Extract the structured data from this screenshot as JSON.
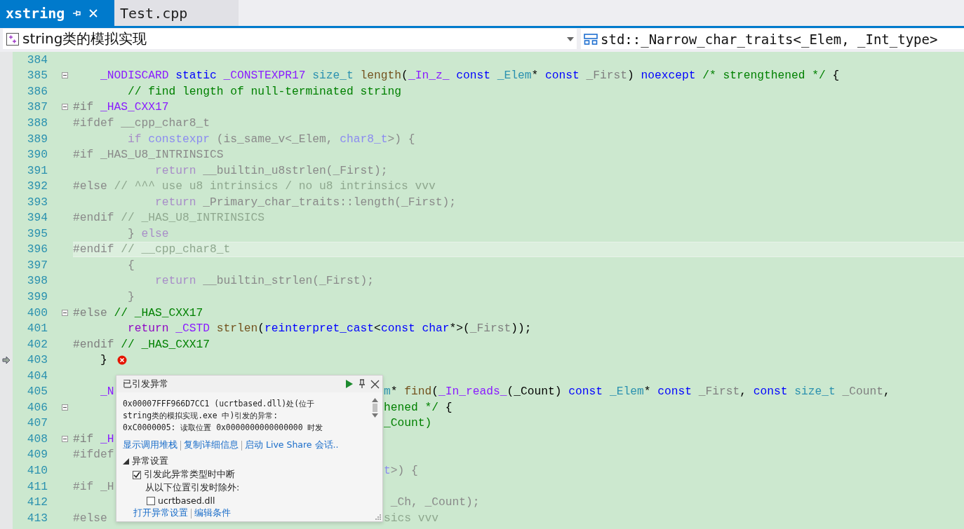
{
  "tabs": [
    {
      "label": "xstring",
      "selected": true
    },
    {
      "label": "Test.cpp",
      "selected": false
    }
  ],
  "nav": {
    "project": "string类的模拟实现",
    "scope": "std::_Narrow_char_traits<_Elem, _Int_type>"
  },
  "lines": [
    {
      "number": "384"
    },
    {
      "number": "385",
      "fold": true,
      "left": [
        {
          "t": "    _NODISCARD ",
          "kind": "mac"
        },
        {
          "t": "static ",
          "kind": "kw"
        },
        {
          "t": "_CONSTEXPR17 ",
          "kind": "mac"
        },
        {
          "t": "size_t ",
          "kind": "type"
        },
        {
          "t": "length",
          "kind": "fn"
        },
        {
          "t": "(",
          "kind": "pl"
        },
        {
          "t": "_In_z_ ",
          "kind": "mac"
        },
        {
          "t": "const ",
          "kind": "kw"
        },
        {
          "t": "_Elem",
          "kind": "type"
        },
        {
          "t": "* ",
          "kind": "pl"
        },
        {
          "t": "const ",
          "kind": "kw"
        },
        {
          "t": "_First",
          "kind": "par"
        },
        {
          "t": ") ",
          "kind": "pl"
        },
        {
          "t": "noexcept ",
          "kind": "kw"
        },
        {
          "t": "/* strengthened */",
          "kind": "cm"
        },
        {
          "t": " {",
          "kind": "pl"
        }
      ]
    },
    {
      "number": "386",
      "left": [
        {
          "t": "        // find length of null-terminated string",
          "kind": "cm"
        }
      ]
    },
    {
      "number": "387",
      "fold": true,
      "left": [
        {
          "t": "#if ",
          "kind": "pre"
        },
        {
          "t": "_HAS_CXX17",
          "kind": "mac"
        }
      ]
    },
    {
      "number": "388",
      "left": [
        {
          "t": "#ifdef __cpp_char8_t",
          "kind": "ip"
        }
      ]
    },
    {
      "number": "389",
      "left": [
        {
          "t": "        if ",
          "kind": "ictl"
        },
        {
          "t": "constexpr",
          "kind": "ikw"
        },
        {
          "t": " (is_same_v<_Elem, ",
          "kind": "ip"
        },
        {
          "t": "char8_t",
          "kind": "ikw"
        },
        {
          "t": ">) {",
          "kind": "ip"
        }
      ]
    },
    {
      "number": "390",
      "left": [
        {
          "t": "#if _HAS_U8_INTRINSICS",
          "kind": "ip"
        }
      ]
    },
    {
      "number": "391",
      "left": [
        {
          "t": "            return",
          "kind": "ictl"
        },
        {
          "t": " __builtin_u8strlen(_First);",
          "kind": "ip"
        }
      ]
    },
    {
      "number": "392",
      "left": [
        {
          "t": "#else",
          "kind": "ip"
        },
        {
          "t": " // ^^^ use u8 intrinsics / no u8 intrinsics vvv",
          "kind": "icm"
        }
      ]
    },
    {
      "number": "393",
      "left": [
        {
          "t": "            return",
          "kind": "ictl"
        },
        {
          "t": " _Primary_char_traits::length(_First);",
          "kind": "ip"
        }
      ]
    },
    {
      "number": "394",
      "left": [
        {
          "t": "#endif",
          "kind": "ip"
        },
        {
          "t": " // _HAS_U8_INTRINSICS",
          "kind": "icm"
        }
      ]
    },
    {
      "number": "395",
      "left": [
        {
          "t": "        } ",
          "kind": "ip"
        },
        {
          "t": "else",
          "kind": "ictl"
        }
      ]
    },
    {
      "number": "396",
      "current": true,
      "left": [
        {
          "t": "#endif",
          "kind": "ip"
        },
        {
          "t": " // __cpp_char8_t",
          "kind": "icm"
        }
      ]
    },
    {
      "number": "397",
      "left": [
        {
          "t": "        {",
          "kind": "ip"
        }
      ]
    },
    {
      "number": "398",
      "left": [
        {
          "t": "            return",
          "kind": "ictl"
        },
        {
          "t": " __builtin_strlen(_First);",
          "kind": "ip"
        }
      ]
    },
    {
      "number": "399",
      "left": [
        {
          "t": "        }",
          "kind": "ip"
        }
      ]
    },
    {
      "number": "400",
      "fold": true,
      "left": [
        {
          "t": "#else",
          "kind": "pre"
        },
        {
          "t": " // _HAS_CXX17",
          "kind": "cm"
        }
      ]
    },
    {
      "number": "401",
      "left": [
        {
          "t": "        return ",
          "kind": "ctl"
        },
        {
          "t": "_CSTD ",
          "kind": "mac"
        },
        {
          "t": "strlen",
          "kind": "fn"
        },
        {
          "t": "(",
          "kind": "pl"
        },
        {
          "t": "reinterpret_cast",
          "kind": "kw"
        },
        {
          "t": "<",
          "kind": "pl"
        },
        {
          "t": "const char",
          "kind": "kw"
        },
        {
          "t": "*>(",
          "kind": "pl"
        },
        {
          "t": "_First",
          "kind": "par"
        },
        {
          "t": "));",
          "kind": "pl"
        }
      ]
    },
    {
      "number": "402",
      "left": [
        {
          "t": "#endif",
          "kind": "pre"
        },
        {
          "t": " // _HAS_CXX17",
          "kind": "cm"
        }
      ]
    },
    {
      "number": "403",
      "arrow": true,
      "error": true,
      "left": [
        {
          "t": "    }",
          "kind": "pl"
        }
      ]
    },
    {
      "number": "404"
    },
    {
      "number": "405",
      "left": [
        {
          "t": "    _N",
          "kind": "mac"
        }
      ],
      "right": [
        {
          "t": "m",
          "kind": "type"
        },
        {
          "t": "* ",
          "kind": "pl"
        },
        {
          "t": "find",
          "kind": "fn"
        },
        {
          "t": "(",
          "kind": "pl"
        },
        {
          "t": "_In_reads_",
          "kind": "mac"
        },
        {
          "t": "(_Count) ",
          "kind": "pl"
        },
        {
          "t": "const ",
          "kind": "kw"
        },
        {
          "t": "_Elem",
          "kind": "type"
        },
        {
          "t": "* ",
          "kind": "pl"
        },
        {
          "t": "const ",
          "kind": "kw"
        },
        {
          "t": "_First",
          "kind": "par"
        },
        {
          "t": ", ",
          "kind": "pl"
        },
        {
          "t": "const ",
          "kind": "kw"
        },
        {
          "t": "size_t ",
          "kind": "type"
        },
        {
          "t": "_Count",
          "kind": "par"
        },
        {
          "t": ",",
          "kind": "pl"
        }
      ]
    },
    {
      "number": "406",
      "fold": true,
      "right": [
        {
          "t": "hened */",
          "kind": "cm"
        },
        {
          "t": " {",
          "kind": "pl"
        }
      ]
    },
    {
      "number": "407",
      "right": [
        {
          "t": "_Count)",
          "kind": "cm"
        }
      ]
    },
    {
      "number": "408",
      "fold": true,
      "left": [
        {
          "t": "#if ",
          "kind": "pre"
        },
        {
          "t": "_H",
          "kind": "mac"
        }
      ]
    },
    {
      "number": "409",
      "left": [
        {
          "t": "#ifdef",
          "kind": "ip"
        }
      ]
    },
    {
      "number": "410",
      "right": [
        {
          "t": "t",
          "kind": "ikw"
        },
        {
          "t": ">) {",
          "kind": "ip"
        }
      ]
    },
    {
      "number": "411",
      "left": [
        {
          "t": "#if _H",
          "kind": "ip"
        }
      ]
    },
    {
      "number": "412",
      "right": [
        {
          "t": " _Ch, _Count);",
          "kind": "ip"
        }
      ]
    },
    {
      "number": "413",
      "left": [
        {
          "t": "#else",
          "kind": "ip"
        }
      ],
      "right": [
        {
          "t": "sics vvv",
          "kind": "icm"
        }
      ]
    }
  ],
  "popup": {
    "title": "已引发异常",
    "message": [
      "0x00007FFF966D7CC1 (ucrtbased.dll)处(位于",
      "string类的模拟实现.exe 中)引发的异常:",
      "0xC0000005: 读取位置 0x0000000000000000 时发"
    ],
    "links": [
      "显示调用堆栈",
      "复制详细信息",
      "启动 Live Share 会话.."
    ],
    "settings": {
      "label": "异常设置",
      "expanded": true,
      "break_option": {
        "label": "引发此异常类型时中断",
        "checked": true
      },
      "except_label": "从以下位置引发时除外:",
      "modules": [
        {
          "label": "ucrtbased.dll",
          "checked": false
        }
      ],
      "links": [
        "打开异常设置",
        "编辑条件"
      ]
    }
  }
}
